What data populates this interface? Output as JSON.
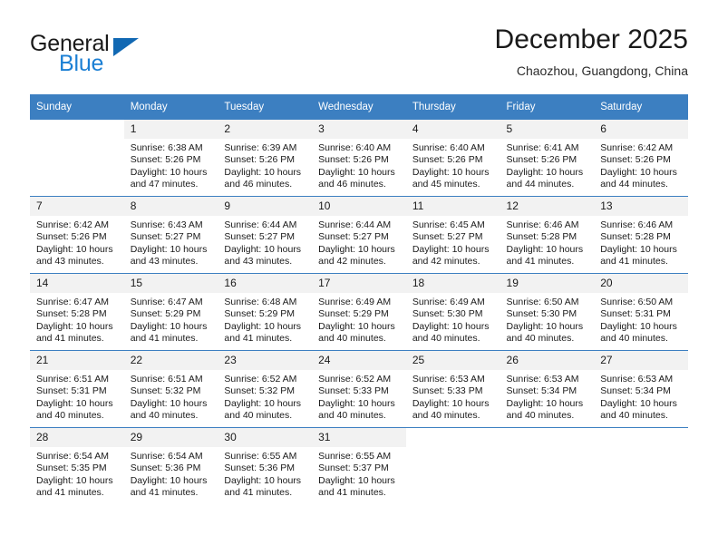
{
  "brand": {
    "name_top": "General",
    "name_bottom": "Blue",
    "triangle_color": "#1168b3",
    "blue_color": "#1b7fd4"
  },
  "header": {
    "title": "December 2025",
    "subtitle": "Chaozhou, Guangdong, China"
  },
  "theme": {
    "header_row_bg": "#3c7fc1",
    "daynum_bg": "#f2f2f2",
    "grid_line": "#3c7fc1"
  },
  "weekday_headers": [
    "Sunday",
    "Monday",
    "Tuesday",
    "Wednesday",
    "Thursday",
    "Friday",
    "Saturday"
  ],
  "weeks": [
    [
      {
        "day": "",
        "sunrise": "",
        "sunset": "",
        "daylight": "",
        "empty": true
      },
      {
        "day": "1",
        "sunrise": "Sunrise: 6:38 AM",
        "sunset": "Sunset: 5:26 PM",
        "daylight": "Daylight: 10 hours and 47 minutes."
      },
      {
        "day": "2",
        "sunrise": "Sunrise: 6:39 AM",
        "sunset": "Sunset: 5:26 PM",
        "daylight": "Daylight: 10 hours and 46 minutes."
      },
      {
        "day": "3",
        "sunrise": "Sunrise: 6:40 AM",
        "sunset": "Sunset: 5:26 PM",
        "daylight": "Daylight: 10 hours and 46 minutes."
      },
      {
        "day": "4",
        "sunrise": "Sunrise: 6:40 AM",
        "sunset": "Sunset: 5:26 PM",
        "daylight": "Daylight: 10 hours and 45 minutes."
      },
      {
        "day": "5",
        "sunrise": "Sunrise: 6:41 AM",
        "sunset": "Sunset: 5:26 PM",
        "daylight": "Daylight: 10 hours and 44 minutes."
      },
      {
        "day": "6",
        "sunrise": "Sunrise: 6:42 AM",
        "sunset": "Sunset: 5:26 PM",
        "daylight": "Daylight: 10 hours and 44 minutes."
      }
    ],
    [
      {
        "day": "7",
        "sunrise": "Sunrise: 6:42 AM",
        "sunset": "Sunset: 5:26 PM",
        "daylight": "Daylight: 10 hours and 43 minutes."
      },
      {
        "day": "8",
        "sunrise": "Sunrise: 6:43 AM",
        "sunset": "Sunset: 5:27 PM",
        "daylight": "Daylight: 10 hours and 43 minutes."
      },
      {
        "day": "9",
        "sunrise": "Sunrise: 6:44 AM",
        "sunset": "Sunset: 5:27 PM",
        "daylight": "Daylight: 10 hours and 43 minutes."
      },
      {
        "day": "10",
        "sunrise": "Sunrise: 6:44 AM",
        "sunset": "Sunset: 5:27 PM",
        "daylight": "Daylight: 10 hours and 42 minutes."
      },
      {
        "day": "11",
        "sunrise": "Sunrise: 6:45 AM",
        "sunset": "Sunset: 5:27 PM",
        "daylight": "Daylight: 10 hours and 42 minutes."
      },
      {
        "day": "12",
        "sunrise": "Sunrise: 6:46 AM",
        "sunset": "Sunset: 5:28 PM",
        "daylight": "Daylight: 10 hours and 41 minutes."
      },
      {
        "day": "13",
        "sunrise": "Sunrise: 6:46 AM",
        "sunset": "Sunset: 5:28 PM",
        "daylight": "Daylight: 10 hours and 41 minutes."
      }
    ],
    [
      {
        "day": "14",
        "sunrise": "Sunrise: 6:47 AM",
        "sunset": "Sunset: 5:28 PM",
        "daylight": "Daylight: 10 hours and 41 minutes."
      },
      {
        "day": "15",
        "sunrise": "Sunrise: 6:47 AM",
        "sunset": "Sunset: 5:29 PM",
        "daylight": "Daylight: 10 hours and 41 minutes."
      },
      {
        "day": "16",
        "sunrise": "Sunrise: 6:48 AM",
        "sunset": "Sunset: 5:29 PM",
        "daylight": "Daylight: 10 hours and 41 minutes."
      },
      {
        "day": "17",
        "sunrise": "Sunrise: 6:49 AM",
        "sunset": "Sunset: 5:29 PM",
        "daylight": "Daylight: 10 hours and 40 minutes."
      },
      {
        "day": "18",
        "sunrise": "Sunrise: 6:49 AM",
        "sunset": "Sunset: 5:30 PM",
        "daylight": "Daylight: 10 hours and 40 minutes."
      },
      {
        "day": "19",
        "sunrise": "Sunrise: 6:50 AM",
        "sunset": "Sunset: 5:30 PM",
        "daylight": "Daylight: 10 hours and 40 minutes."
      },
      {
        "day": "20",
        "sunrise": "Sunrise: 6:50 AM",
        "sunset": "Sunset: 5:31 PM",
        "daylight": "Daylight: 10 hours and 40 minutes."
      }
    ],
    [
      {
        "day": "21",
        "sunrise": "Sunrise: 6:51 AM",
        "sunset": "Sunset: 5:31 PM",
        "daylight": "Daylight: 10 hours and 40 minutes."
      },
      {
        "day": "22",
        "sunrise": "Sunrise: 6:51 AM",
        "sunset": "Sunset: 5:32 PM",
        "daylight": "Daylight: 10 hours and 40 minutes."
      },
      {
        "day": "23",
        "sunrise": "Sunrise: 6:52 AM",
        "sunset": "Sunset: 5:32 PM",
        "daylight": "Daylight: 10 hours and 40 minutes."
      },
      {
        "day": "24",
        "sunrise": "Sunrise: 6:52 AM",
        "sunset": "Sunset: 5:33 PM",
        "daylight": "Daylight: 10 hours and 40 minutes."
      },
      {
        "day": "25",
        "sunrise": "Sunrise: 6:53 AM",
        "sunset": "Sunset: 5:33 PM",
        "daylight": "Daylight: 10 hours and 40 minutes."
      },
      {
        "day": "26",
        "sunrise": "Sunrise: 6:53 AM",
        "sunset": "Sunset: 5:34 PM",
        "daylight": "Daylight: 10 hours and 40 minutes."
      },
      {
        "day": "27",
        "sunrise": "Sunrise: 6:53 AM",
        "sunset": "Sunset: 5:34 PM",
        "daylight": "Daylight: 10 hours and 40 minutes."
      }
    ],
    [
      {
        "day": "28",
        "sunrise": "Sunrise: 6:54 AM",
        "sunset": "Sunset: 5:35 PM",
        "daylight": "Daylight: 10 hours and 41 minutes."
      },
      {
        "day": "29",
        "sunrise": "Sunrise: 6:54 AM",
        "sunset": "Sunset: 5:36 PM",
        "daylight": "Daylight: 10 hours and 41 minutes."
      },
      {
        "day": "30",
        "sunrise": "Sunrise: 6:55 AM",
        "sunset": "Sunset: 5:36 PM",
        "daylight": "Daylight: 10 hours and 41 minutes."
      },
      {
        "day": "31",
        "sunrise": "Sunrise: 6:55 AM",
        "sunset": "Sunset: 5:37 PM",
        "daylight": "Daylight: 10 hours and 41 minutes."
      },
      {
        "day": "",
        "sunrise": "",
        "sunset": "",
        "daylight": "",
        "empty": true
      },
      {
        "day": "",
        "sunrise": "",
        "sunset": "",
        "daylight": "",
        "empty": true
      },
      {
        "day": "",
        "sunrise": "",
        "sunset": "",
        "daylight": "",
        "empty": true
      }
    ]
  ]
}
